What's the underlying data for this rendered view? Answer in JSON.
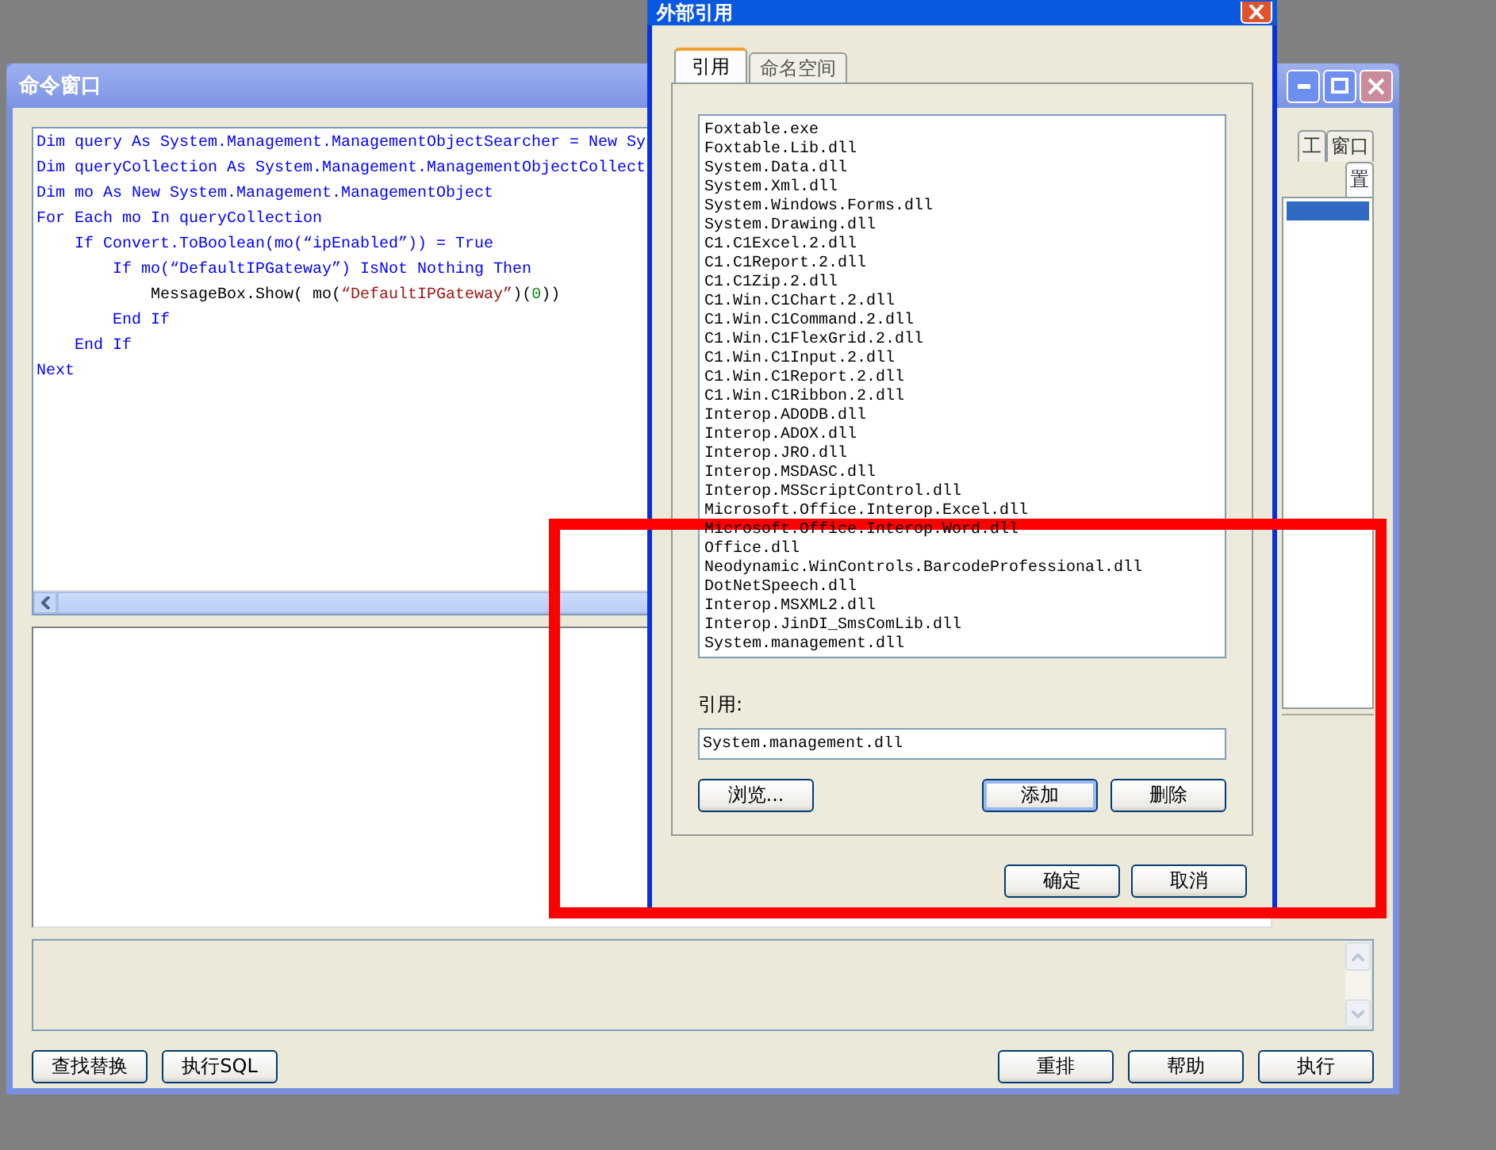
{
  "command_window": {
    "title": "命令窗口",
    "code_lines": [
      [
        {
          "kind": "keyword",
          "text": "Dim query As System.Management.ManagementObjectSearcher = New Sy"
        }
      ],
      [
        {
          "kind": "keyword",
          "text": "Dim queryCollection As System.Management.ManagementObjectCollect"
        }
      ],
      [
        {
          "kind": "keyword",
          "text": "Dim mo As New System.Management.ManagementObject"
        }
      ],
      [
        {
          "kind": "keyword",
          "text": "For Each mo In queryCollection"
        }
      ],
      [
        {
          "kind": "keyword",
          "text": "    If Convert.ToBoolean(mo(“ipEnabled”)) = True"
        }
      ],
      [
        {
          "kind": "keyword",
          "text": "        If mo(“DefaultIPGateway”) IsNot Nothing Then"
        }
      ],
      [
        {
          "kind": "plain",
          "text": "            MessageBox.Show( mo("
        },
        {
          "kind": "string",
          "text": "“DefaultIPGateway”"
        },
        {
          "kind": "plain",
          "text": ")("
        },
        {
          "kind": "number",
          "text": "0"
        },
        {
          "kind": "plain",
          "text": "))"
        }
      ],
      [
        {
          "kind": "keyword",
          "text": "        End If"
        }
      ],
      [
        {
          "kind": "keyword",
          "text": "    End If"
        }
      ],
      [
        {
          "kind": "keyword",
          "text": "Next"
        }
      ]
    ],
    "tab_rows": [
      [
        {
          "label": "工",
          "selected": false
        },
        {
          "label": "窗口",
          "selected": false
        }
      ],
      [
        {
          "label": "置",
          "selected": true
        }
      ]
    ],
    "list_rows": [
      {
        "selected": true
      }
    ],
    "buttons_left": [
      "查找替换",
      "执行SQL"
    ],
    "buttons_right": [
      "重排",
      "帮助",
      "执行"
    ]
  },
  "dialog": {
    "title": "外部引用",
    "tabs": [
      {
        "label": "引用",
        "selected": true
      },
      {
        "label": "命名空间",
        "selected": false
      }
    ],
    "references": [
      "Foxtable.exe",
      "Foxtable.Lib.dll",
      "System.Data.dll",
      "System.Xml.dll",
      "System.Windows.Forms.dll",
      "System.Drawing.dll",
      "C1.C1Excel.2.dll",
      "C1.C1Report.2.dll",
      "C1.C1Zip.2.dll",
      "C1.Win.C1Chart.2.dll",
      "C1.Win.C1Command.2.dll",
      "C1.Win.C1FlexGrid.2.dll",
      "C1.Win.C1Input.2.dll",
      "C1.Win.C1Report.2.dll",
      "C1.Win.C1Ribbon.2.dll",
      "Interop.ADODB.dll",
      "Interop.ADOX.dll",
      "Interop.JRO.dll",
      "Interop.MSDASC.dll",
      "Interop.MSScriptControl.dll",
      "Microsoft.Office.Interop.Excel.dll",
      "Microsoft.Office.Interop.Word.dll",
      "Office.dll",
      "Neodynamic.WinControls.BarcodeProfessional.dll",
      "DotNetSpeech.dll",
      "Interop.MSXML2.dll",
      "Interop.JinDI_SmsComLib.dll",
      "System.management.dll"
    ],
    "reference_label": "引用:",
    "reference_value": "System.management.dll",
    "buttons": [
      {
        "label": "浏览...",
        "default": false
      },
      {
        "label": "添加",
        "default": true
      },
      {
        "label": "删除",
        "default": false
      }
    ],
    "footer_buttons": [
      "确定",
      "取消"
    ]
  }
}
